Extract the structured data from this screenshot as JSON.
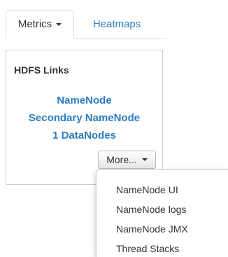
{
  "tabs": [
    {
      "label": "Metrics",
      "active": true,
      "has_dropdown": true
    },
    {
      "label": "Heatmaps",
      "active": false
    }
  ],
  "panel": {
    "title": "HDFS Links",
    "links": [
      "NameNode",
      "Secondary NameNode",
      "1 DataNodes"
    ],
    "more_button_label": "More..."
  },
  "dropdown": {
    "items": [
      "NameNode UI",
      "NameNode logs",
      "NameNode JMX",
      "Thread Stacks"
    ]
  },
  "colors": {
    "link": "#2a7dc2",
    "text": "#333333",
    "border": "#cccccc"
  },
  "icons": {
    "tab_caret": "caret-down-icon",
    "more_caret": "caret-down-icon"
  }
}
